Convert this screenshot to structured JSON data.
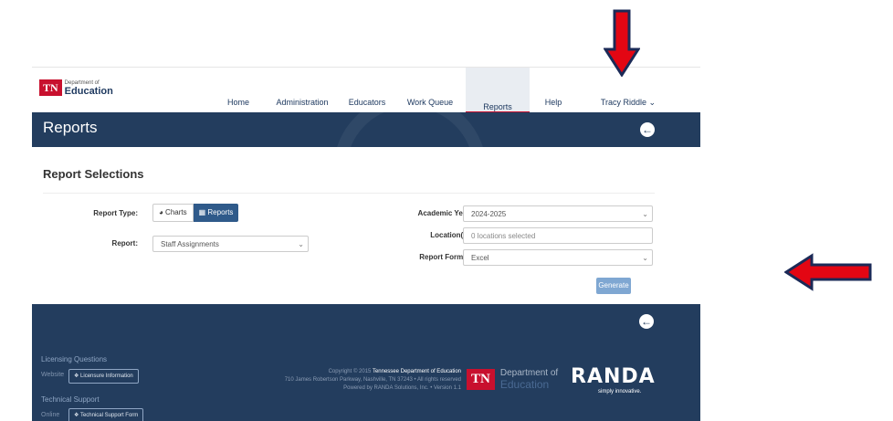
{
  "header": {
    "logo_tn": "TN",
    "logo_dept_line1": "Department of",
    "logo_dept_line2": "Education",
    "nav": [
      {
        "label": "Home"
      },
      {
        "label": "Administration"
      },
      {
        "label": "Educators"
      },
      {
        "label": "Work Queue"
      },
      {
        "label": "Reports"
      },
      {
        "label": "Help"
      },
      {
        "label": "Tracy Riddle ⌄"
      }
    ]
  },
  "banner": {
    "title": "Reports",
    "action_icon": "circle-arrow-left-icon"
  },
  "main": {
    "section_title": "Report Selections",
    "report_type_label": "Report Type:",
    "charts_label": "◕ Charts",
    "reports_label": "▦ Reports",
    "report_label": "Report:",
    "report_value": "Staff Assignments",
    "academic_year_label": "Academic Year:",
    "academic_year_value": "2024-2025",
    "locations_label": "Location(s):",
    "locations_placeholder": "0 locations selected",
    "report_format_label": "Report Format:",
    "report_format_value": "Excel",
    "generate_label": "Generate"
  },
  "footer": {
    "licensing_heading": "Licensing Questions",
    "website_label": "Website",
    "licensure_button": "Licensure Information",
    "tech_heading": "Technical Support",
    "online_label": "Online",
    "tech_button": "Technical Support Form",
    "copyright_prefix": "Copyright © 2015",
    "copyright_org": "Tennessee Department of Education",
    "address": "710 James Robertson Parkway, Nashville, TN 37243 • All rights reserved",
    "powered": "Powered by RANDA Solutions, Inc. • Version 1.1",
    "tn_logo": "TN",
    "tn_dept": "Department of",
    "tn_edu": "Education",
    "randa": "RANDA",
    "randa_tagline": "simply innovative."
  },
  "colors": {
    "brand_navy": "#233d5e",
    "brand_red": "#c8102e",
    "button_blue": "#7fa7d2",
    "annotation_arrow": "#e30613"
  }
}
